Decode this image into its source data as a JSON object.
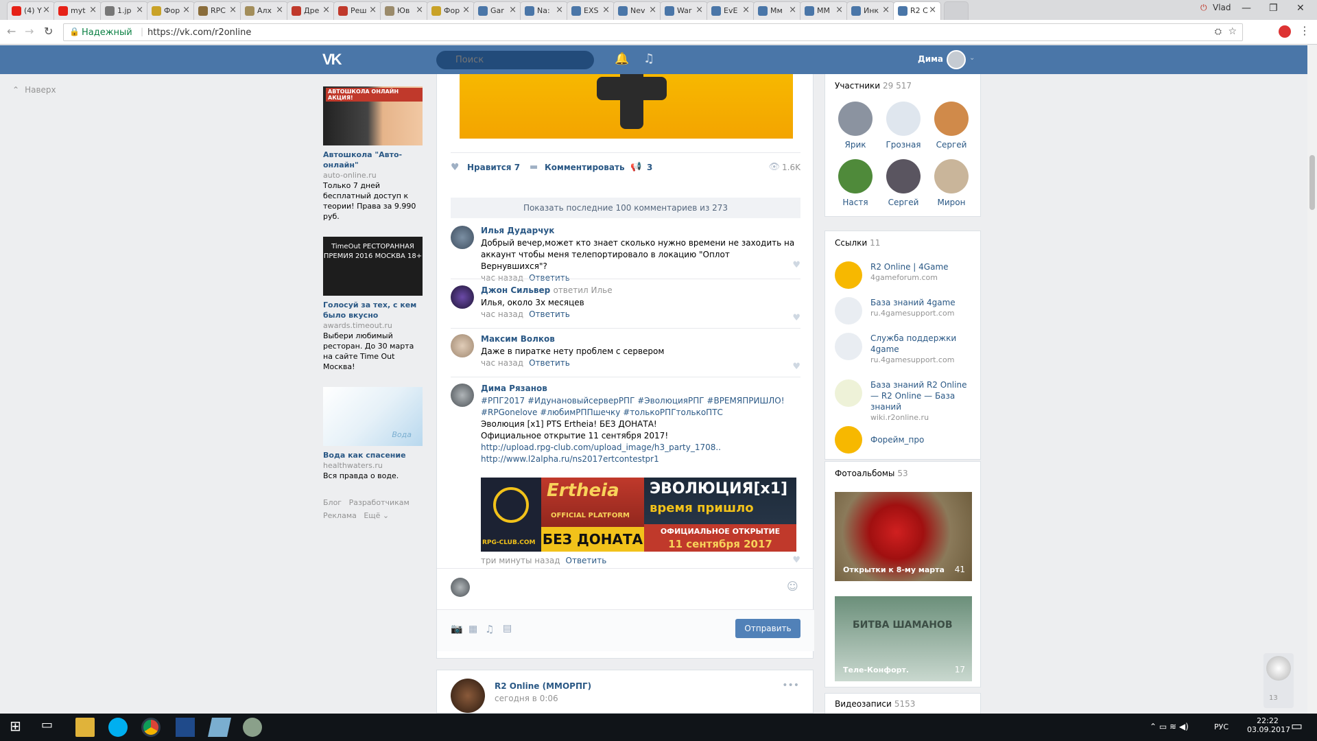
{
  "tabs": [
    {
      "label": "(4) Y",
      "color": "#e62117"
    },
    {
      "label": "myt",
      "color": "#e62117"
    },
    {
      "label": "1.jp",
      "color": "#777777"
    },
    {
      "label": "Фор",
      "color": "#c9a227"
    },
    {
      "label": "RPC",
      "color": "#8a6d3b"
    },
    {
      "label": "Алх",
      "color": "#a38e5b"
    },
    {
      "label": "Дре",
      "color": "#c0392b"
    },
    {
      "label": "Реш",
      "color": "#c0392b"
    },
    {
      "label": "Юв",
      "color": "#9b8b6b"
    },
    {
      "label": "Фор",
      "color": "#c9a227"
    },
    {
      "label": "Gar",
      "color": "#4a76a8"
    },
    {
      "label": "Na:",
      "color": "#4a76a8"
    },
    {
      "label": "EXS",
      "color": "#4a76a8"
    },
    {
      "label": "Nev",
      "color": "#4a76a8"
    },
    {
      "label": "War",
      "color": "#4a76a8"
    },
    {
      "label": "EvE",
      "color": "#4a76a8"
    },
    {
      "label": "Mм",
      "color": "#4a76a8"
    },
    {
      "label": "MM",
      "color": "#4a76a8"
    },
    {
      "label": "Инк",
      "color": "#4a76a8"
    },
    {
      "label": "R2 C",
      "color": "#4a76a8",
      "active": true
    }
  ],
  "window_user": "Vlad",
  "address": {
    "secure_label": "Надежный",
    "url": "https://vk.com/r2online"
  },
  "header": {
    "logo": "VK",
    "search_placeholder": "Поиск",
    "username": "Дима"
  },
  "leftnav": {
    "up_label": "Наверх"
  },
  "ads": [
    {
      "title": "Автошкола \"Авто-онлайн\"",
      "domain": "auto-online.ru",
      "text": "Только 7 дней бесплатный доступ к теории! Права за 9.990 руб.",
      "banner": "АВТОШКОЛА ОНЛАЙН АКЦИЯ!"
    },
    {
      "title": "Голосуй за тех, с кем было вкусно",
      "domain": "awards.timeout.ru",
      "text": "Выбери любимый ресторан. До 30 марта на сайте Time Out Москва!",
      "banner": "TimeOut РЕСТОРАННАЯ ПРЕМИЯ 2016 МОСКВА 18+"
    },
    {
      "title": "Вода как спасение",
      "domain": "healthwaters.ru",
      "text": "Вся правда о воде.",
      "banner": "Вода"
    }
  ],
  "footer_links": [
    "Блог",
    "Разработчикам",
    "Реклама",
    "Ещё ⌄"
  ],
  "post_actions": {
    "like_label": "Нравится",
    "like_count": "7",
    "comment_label": "Комментировать",
    "share_count": "3",
    "views": "1.6K"
  },
  "show_comments": "Показать последние 100 комментариев из 273",
  "comments": [
    {
      "author": "Илья Дударчук",
      "suffix": "",
      "text": "Добрый вечер,может кто знает сколько нужно времени не заходить на аккаунт чтобы меня телепортировало в локацию \"Оплот Вернувшихся\"?",
      "time": "час назад",
      "reply": "Ответить"
    },
    {
      "author": "Джон Сильвер",
      "suffix": "ответил Илье",
      "text": "Илья, около 3х месяцев",
      "time": "час назад",
      "reply": "Ответить"
    },
    {
      "author": "Максим Волков",
      "suffix": "",
      "text": "Даже в пиратке нету проблем с сервером",
      "time": "час назад",
      "reply": "Ответить"
    },
    {
      "author": "Дима Рязанов",
      "suffix": "",
      "text": "",
      "time": "три минуты назад",
      "reply": "Ответить"
    }
  ],
  "long_comment": {
    "hashtags1": "#РПГ2017 #ИдунановыйсерверРПГ #ЭволюцияРПГ #ВРЕМЯПРИШЛО!",
    "hashtags2": "#RPGonelove #любимРППшечку #толькоРПГтолькоПТС",
    "line1": "Эволюция [x1] PTS Ertheia! БЕЗ ДОНАТА!",
    "line2": "Официальное открытие 11 сентября 2017!",
    "link1": "http://upload.rpg-club.com/upload_image/h3_party_1708..",
    "link2": "http://www.l2alpha.ru/ns2017ertcontestpr1",
    "banner_left": "RPG-CLUB.COM",
    "banner_mid_top": "Ertheia",
    "banner_mid_sub": "OFFICIAL PLATFORM",
    "banner_mid_bottom": "БЕЗ ДОНАТА",
    "banner_right_top": "ЭВОЛЮЦИЯ[x1]",
    "banner_right_mid": "время пришло",
    "banner_right_bottom1": "ОФИЦИАЛЬНОЕ ОТКРЫТИЕ",
    "banner_right_bottom2": "11 сентября 2017"
  },
  "composer": {
    "send_label": "Отправить"
  },
  "next_post": {
    "author": "R2 Online (ММОРПГ)",
    "time": "сегодня в 0:06"
  },
  "members": {
    "title": "Участники",
    "count": "29 517",
    "list": [
      {
        "name": "Ярик",
        "color": "#8b93a0"
      },
      {
        "name": "Грозная",
        "color": "#dfe6ee"
      },
      {
        "name": "Сергей",
        "color": "#d08a4a"
      },
      {
        "name": "Настя",
        "color": "#4f8a3a"
      },
      {
        "name": "Сергей",
        "color": "#5a5560"
      },
      {
        "name": "Мирон",
        "color": "#c9b59a"
      }
    ]
  },
  "links": {
    "title": "Ссылки",
    "count": "11",
    "list": [
      {
        "name": "R2 Online | 4Game",
        "url": "4gameforum.com"
      },
      {
        "name": "База знаний 4game",
        "url": "ru.4gamesupport.com"
      },
      {
        "name": "Служба поддержки 4game",
        "url": "ru.4gamesupport.com"
      },
      {
        "name": "База знаний R2 Online — R2 Online — База знаний",
        "url": "wiki.r2online.ru"
      },
      {
        "name": "Форейм_про",
        "url": ""
      }
    ]
  },
  "albums": {
    "title": "Фотоальбомы",
    "count": "53",
    "list": [
      {
        "name": "Открытки к 8-му марта",
        "count": "41"
      },
      {
        "name": "Теле-Конфорт.",
        "count": "17",
        "banner": "БИТВА ШАМАНОВ"
      }
    ]
  },
  "videos": {
    "title": "Видеозаписи",
    "count": "5153"
  },
  "floating": {
    "count": "13"
  },
  "taskbar": {
    "lang": "РУС",
    "time": "22:22",
    "date": "03.09.2017"
  }
}
